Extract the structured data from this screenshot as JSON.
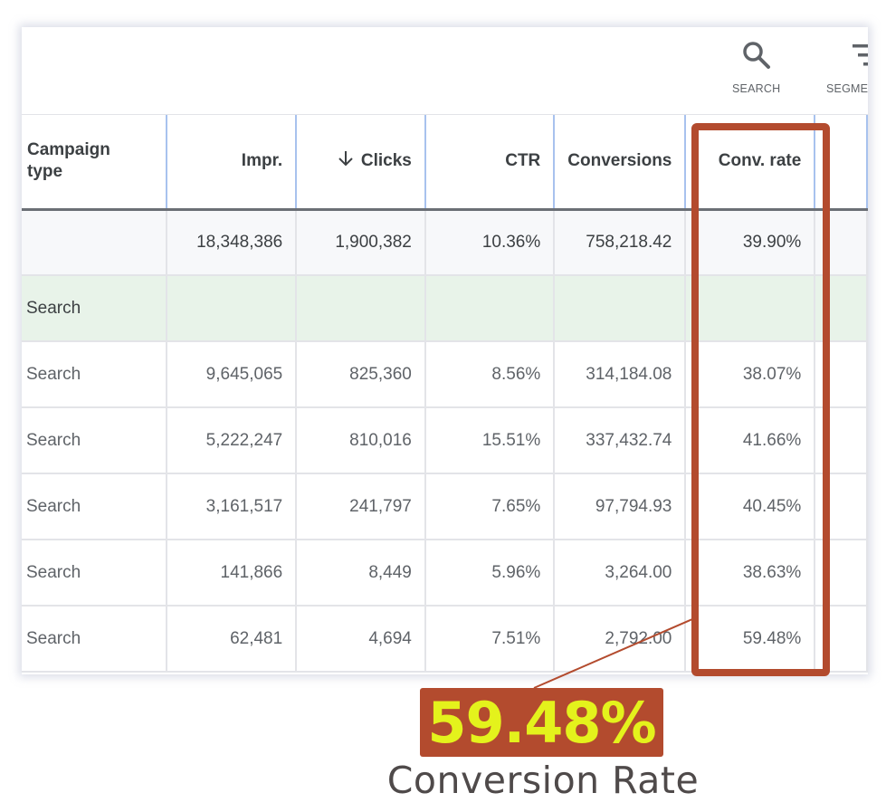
{
  "toolbar": {
    "buttons": [
      {
        "label": "SEARCH",
        "icon": "search-icon"
      },
      {
        "label": "SEGMENT",
        "icon": "filter-lines-icon"
      }
    ]
  },
  "table": {
    "columns": [
      {
        "label": "Campaign type",
        "line1": "Campaign",
        "line2": "type"
      },
      {
        "label": "Impr."
      },
      {
        "label": "Clicks",
        "sorted": "descending"
      },
      {
        "label": "CTR"
      },
      {
        "label": "Conversions"
      },
      {
        "label": "Conv. rate"
      }
    ],
    "total_row": {
      "campaign_type": "",
      "impr": "18,348,386",
      "clicks": "1,900,382",
      "ctr": "10.36%",
      "conversions": "758,218.42",
      "conv_rate": "39.90%"
    },
    "group_row": {
      "campaign_type": "Search"
    },
    "rows": [
      {
        "campaign_type": "Search",
        "impr": "9,645,065",
        "clicks": "825,360",
        "ctr": "8.56%",
        "conversions": "314,184.08",
        "conv_rate": "38.07%"
      },
      {
        "campaign_type": "Search",
        "impr": "5,222,247",
        "clicks": "810,016",
        "ctr": "15.51%",
        "conversions": "337,432.74",
        "conv_rate": "41.66%"
      },
      {
        "campaign_type": "Search",
        "impr": "3,161,517",
        "clicks": "241,797",
        "ctr": "7.65%",
        "conversions": "97,794.93",
        "conv_rate": "40.45%"
      },
      {
        "campaign_type": "Search",
        "impr": "141,866",
        "clicks": "8,449",
        "ctr": "5.96%",
        "conversions": "3,264.00",
        "conv_rate": "38.63%"
      },
      {
        "campaign_type": "Search",
        "impr": "62,481",
        "clicks": "4,694",
        "ctr": "7.51%",
        "conversions": "2,792.00",
        "conv_rate": "59.48%"
      }
    ]
  },
  "annotation": {
    "value": "59.48%",
    "caption": "Conversion Rate",
    "colors": {
      "accent": "#b34b2e",
      "value_text": "#e4f21c",
      "caption_text": "#4f4a4a"
    }
  }
}
